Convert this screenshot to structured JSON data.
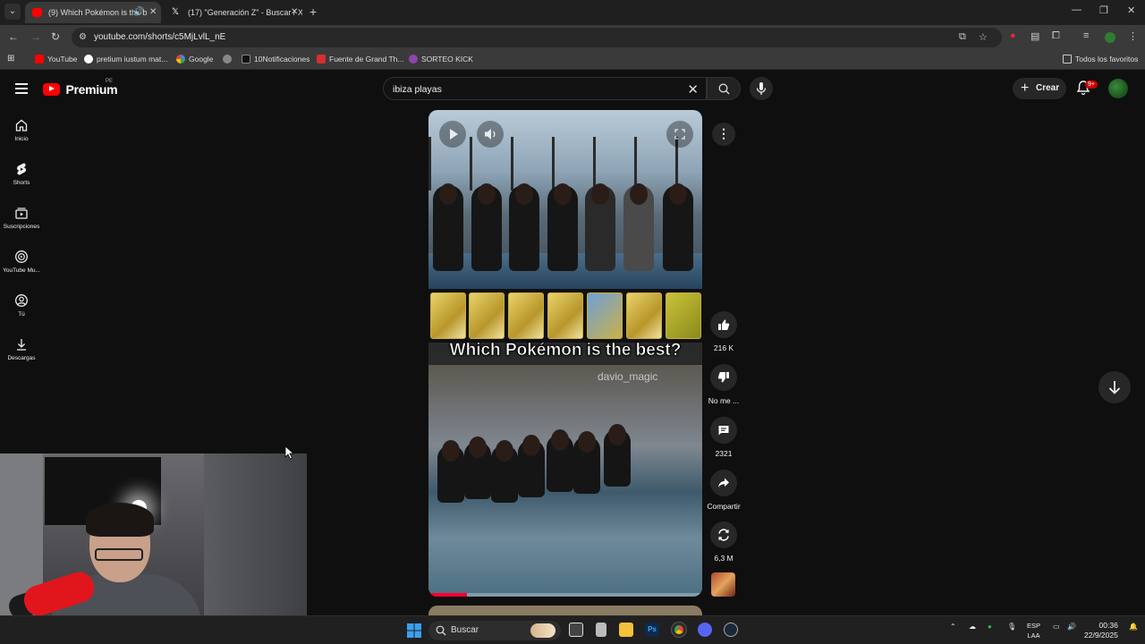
{
  "browser": {
    "tabs": [
      {
        "title": "(9) Which Pokémon is the b",
        "active": true
      },
      {
        "title": "(17) \"Generación Z\" - Buscar / X",
        "active": false
      }
    ],
    "url": "youtube.com/shorts/c5MjLvlL_nE",
    "bookmarks": [
      "YouTube",
      "pretium iustum mat...",
      "Google",
      "10Notificaciones",
      "Fuente de Grand Th...",
      "SORTEO KICK"
    ],
    "all_bookmarks_label": "Todos los favoritos"
  },
  "youtube": {
    "logo_text": "Premium",
    "region": "PE",
    "search": {
      "value": "ibiza playas"
    },
    "create_label": "Crear",
    "notification_badge": "9+",
    "sidebar": [
      {
        "label": "Inicio",
        "icon": "home-icon"
      },
      {
        "label": "Shorts",
        "icon": "shorts-icon"
      },
      {
        "label": "Suscripciones",
        "icon": "subscriptions-icon"
      },
      {
        "label": "YouTube Mu...",
        "icon": "youtube-music-icon"
      },
      {
        "label": "Tú",
        "icon": "you-icon"
      },
      {
        "label": "Descargas",
        "icon": "download-icon"
      }
    ],
    "short": {
      "caption": "Which Pokémon is the best?",
      "handle": "davio_magic",
      "progress": 0.14
    },
    "actions": {
      "likes": "216 K",
      "dislike": "No me ...",
      "comments": "2321",
      "share": "Compartir",
      "remix": "6,3 M"
    }
  },
  "taskbar": {
    "search_placeholder": "Buscar",
    "lang_line1": "ESP",
    "lang_line2": "LAA",
    "time": "00:36",
    "date": "22/9/2025"
  },
  "colors": {
    "accent": "#ff0000",
    "background": "#0f0f0f",
    "chip": "#272727"
  }
}
